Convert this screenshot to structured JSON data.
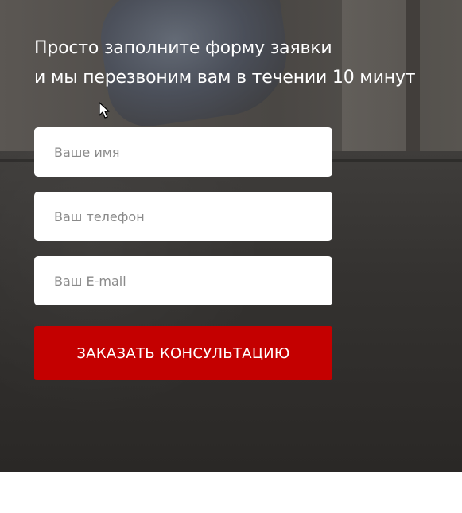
{
  "form": {
    "headline_line1": "Просто заполните форму заявки",
    "headline_line2": "и мы перезвоним вам в течении 10 минут",
    "name_placeholder": "Ваше имя",
    "phone_placeholder": "Ваш телефон",
    "email_placeholder": "Ваш E-mail",
    "submit_label": "ЗАКАЗАТЬ КОНСУЛЬТАЦИЮ"
  },
  "colors": {
    "accent": "#c40000",
    "text": "#ffffff",
    "field_bg": "#ffffff"
  },
  "icons": {
    "cursor": "mouse-pointer-icon"
  }
}
